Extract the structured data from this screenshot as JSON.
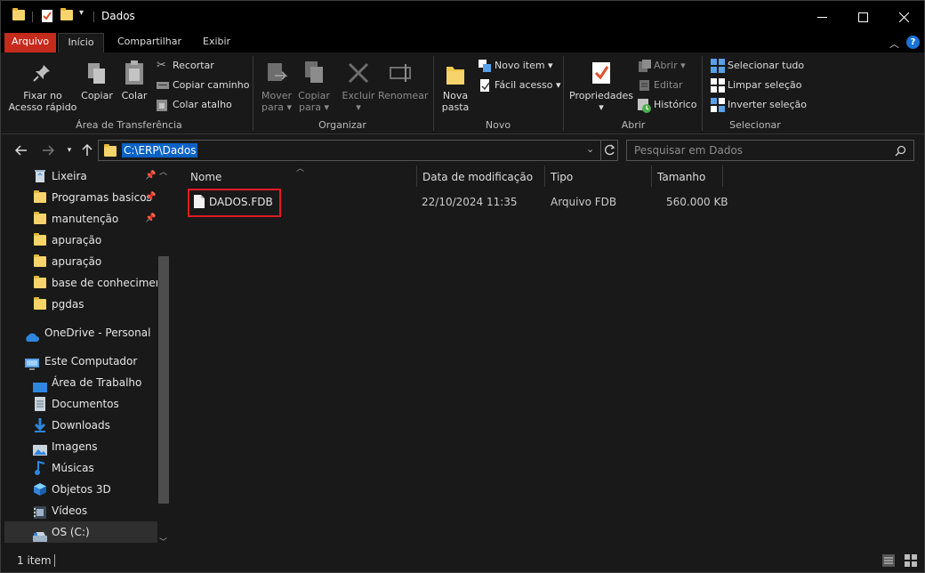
{
  "window": {
    "title": "Dados"
  },
  "ribbon_tabs": [
    "Arquivo",
    "Início",
    "Compartilhar",
    "Exibir"
  ],
  "ribbon": {
    "clipboard": {
      "pin_label_1": "Fixar no",
      "pin_label_2": "Acesso rápido",
      "copy": "Copiar",
      "paste": "Colar",
      "cut": "Recortar",
      "copy_path": "Copiar caminho",
      "paste_shortcut": "Colar atalho",
      "group": "Área de Transferência"
    },
    "organize": {
      "move_1": "Mover",
      "move_2": "para",
      "copy_1": "Copiar",
      "copy_2": "para",
      "delete": "Excluir",
      "rename": "Renomear",
      "group": "Organizar"
    },
    "new": {
      "new_folder_1": "Nova",
      "new_folder_2": "pasta",
      "new_item": "Novo item",
      "easy_access": "Fácil acesso",
      "group": "Novo"
    },
    "open": {
      "properties": "Propriedades",
      "open": "Abrir",
      "edit": "Editar",
      "history": "Histórico",
      "group": "Abrir"
    },
    "select": {
      "select_all": "Selecionar tudo",
      "select_none": "Limpar seleção",
      "invert": "Inverter seleção",
      "group": "Selecionar"
    }
  },
  "address": {
    "path": "C:\\ERP\\Dados",
    "search_placeholder": "Pesquisar em Dados"
  },
  "sidebar": {
    "items": [
      {
        "label": "Lixeira",
        "pinned": true
      },
      {
        "label": "Programas basicos",
        "pinned": true
      },
      {
        "label": "manutenção",
        "pinned": true
      },
      {
        "label": "apuração",
        "pinned": false
      },
      {
        "label": "apuração",
        "pinned": false
      },
      {
        "label": "base de conhecimento",
        "pinned": false
      },
      {
        "label": "pgdas",
        "pinned": false
      },
      {
        "label": "OneDrive - Personal"
      },
      {
        "label": "Este Computador"
      },
      {
        "label": "Área de Trabalho"
      },
      {
        "label": "Documentos"
      },
      {
        "label": "Downloads"
      },
      {
        "label": "Imagens"
      },
      {
        "label": "Músicas"
      },
      {
        "label": "Objetos 3D"
      },
      {
        "label": "Vídeos"
      },
      {
        "label": "OS (C:)"
      }
    ]
  },
  "columns": {
    "name": "Nome",
    "modified": "Data de modificação",
    "type": "Tipo",
    "size": "Tamanho"
  },
  "files": [
    {
      "name": "DADOS.FDB",
      "modified": "22/10/2024 11:35",
      "type": "Arquivo FDB",
      "size": "560.000 KB"
    }
  ],
  "status": {
    "count": "1 item"
  },
  "colors": {
    "accent_file_tab": "#c42b1c",
    "selection": "#0a62c4",
    "highlight_box": "#e01b24"
  }
}
